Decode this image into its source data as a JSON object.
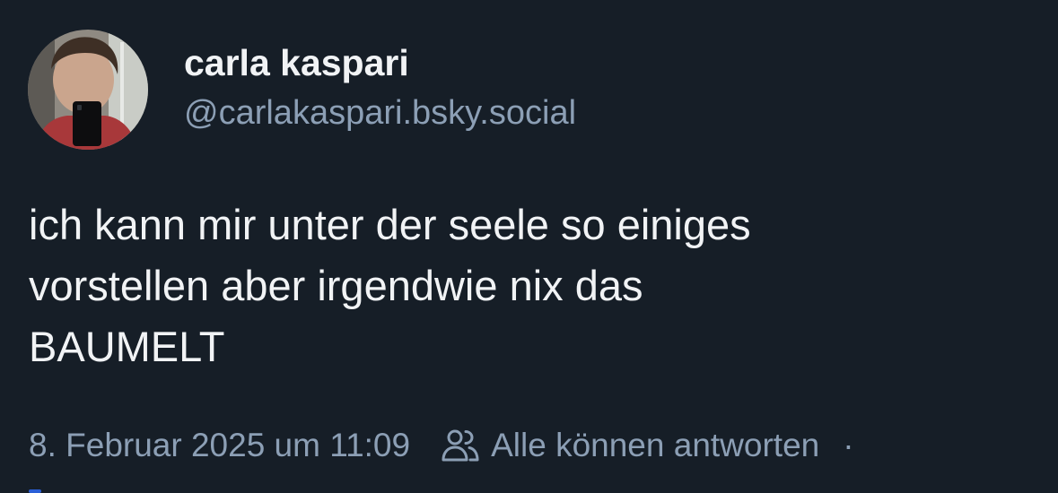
{
  "author": {
    "display_name": "carla kaspari",
    "handle": "@carlakaspari.bsky.social",
    "avatar_icon": "profile-photo"
  },
  "post": {
    "text": "ich kann mir unter der seele so einiges\nvorstellen aber irgendwie nix das\nBAUMELT"
  },
  "meta": {
    "timestamp": "8. Februar 2025 um 11:09",
    "reply_setting_icon": "people-icon",
    "reply_setting_label": "Alle können antworten",
    "separator": "·"
  },
  "colors": {
    "background": "#161e27",
    "primary_text": "#f1f3f5",
    "secondary_text": "#8c9fb5"
  }
}
